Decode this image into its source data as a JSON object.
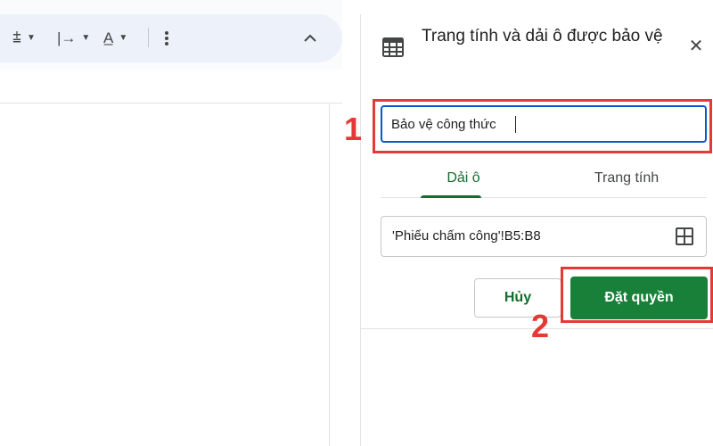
{
  "toolbar": {
    "items": [
      {
        "name": "vertical-align-icon",
        "glyph": "⩲"
      },
      {
        "name": "text-wrap-icon",
        "glyph": "|→"
      },
      {
        "name": "text-rotation-icon",
        "glyph": "A̲"
      }
    ],
    "more_icon": "more-vert-icon",
    "collapse_icon": "chevron-up-icon"
  },
  "panel": {
    "title": "Trang tính và dải ô được bảo vệ",
    "icon": "table-icon",
    "close_glyph": "✕",
    "description_input": {
      "value": "Bảo vệ công thức",
      "placeholder": ""
    },
    "tabs": [
      {
        "label": "Dải ô",
        "active": true
      },
      {
        "label": "Trang tính",
        "active": false
      }
    ],
    "range": {
      "value": "'Phiếu chấm công'!B5:B8",
      "icon": "grid-select-icon"
    },
    "cancel_label": "Hủy",
    "save_label": "Đặt quyền"
  },
  "annotations": {
    "step1": "1",
    "step2": "2",
    "color": "#e53935"
  },
  "colors": {
    "accent_green": "#188038",
    "tab_green": "#146c2e",
    "focus_blue": "#0b57d0"
  }
}
